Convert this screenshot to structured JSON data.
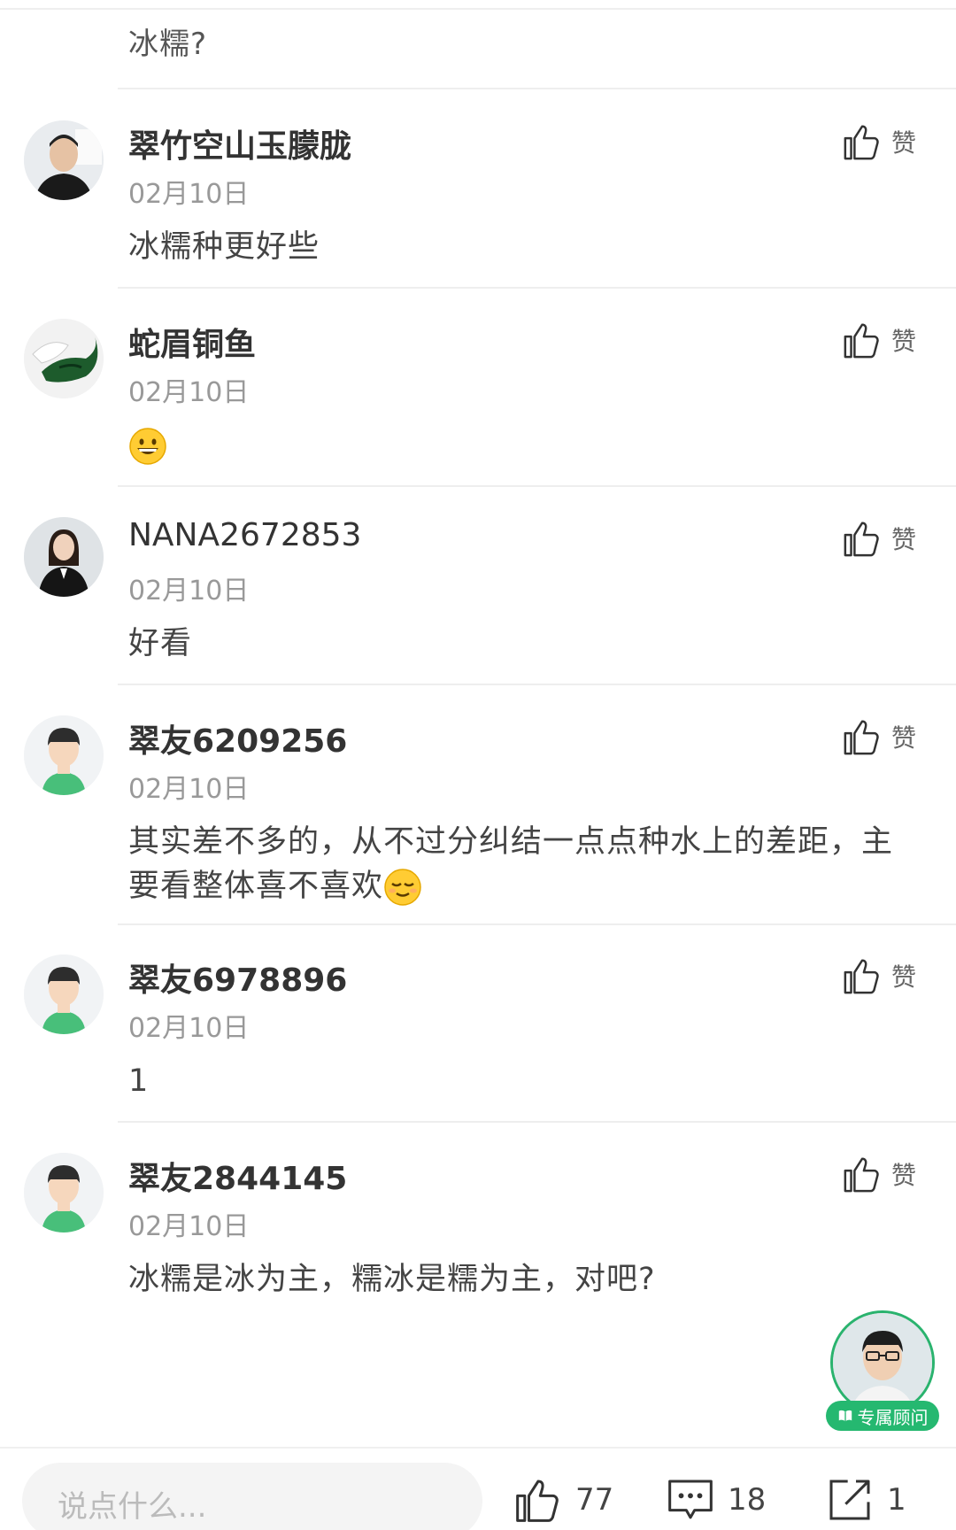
{
  "top": {
    "partial_comment": "冰糯?"
  },
  "comments": [
    {
      "name": "翠竹空山玉朦胧",
      "date": "02月10日",
      "text": "冰糯种更好些",
      "like_label": "赞",
      "avatar": "man-photo-avatar"
    },
    {
      "name": "蛇眉铜鱼",
      "date": "02月10日",
      "text": "",
      "emoji": "grinning-face-emoji",
      "like_label": "赞",
      "avatar": "jade-carving-avatar"
    },
    {
      "name": "NANA2672853",
      "date": "02月10日",
      "text": "好看",
      "like_label": "赞",
      "avatar": "woman-photo-avatar"
    },
    {
      "name": "翠友6209256",
      "date": "02月10日",
      "text": "其实差不多的，从不过分纠结一点点种水上的差距，主要看整体喜不喜欢",
      "emoji": "relieved-face-emoji",
      "like_label": "赞",
      "avatar": "default-user-avatar"
    },
    {
      "name": "翠友6978896",
      "date": "02月10日",
      "text": "1",
      "like_label": "赞",
      "avatar": "default-user-avatar"
    },
    {
      "name": "翠友2844145",
      "date": "02月10日",
      "text": "冰糯是冰为主，糯冰是糯为主，对吧?",
      "like_label": "赞",
      "avatar": "default-user-avatar"
    }
  ],
  "advisor": {
    "label": "专属顾问"
  },
  "bottom_bar": {
    "input_placeholder": "说点什么...",
    "likes": "77",
    "comments": "18",
    "shares": "1"
  },
  "colors": {
    "accent_green": "#25b870",
    "text_primary": "#333333",
    "text_secondary": "#999999"
  }
}
